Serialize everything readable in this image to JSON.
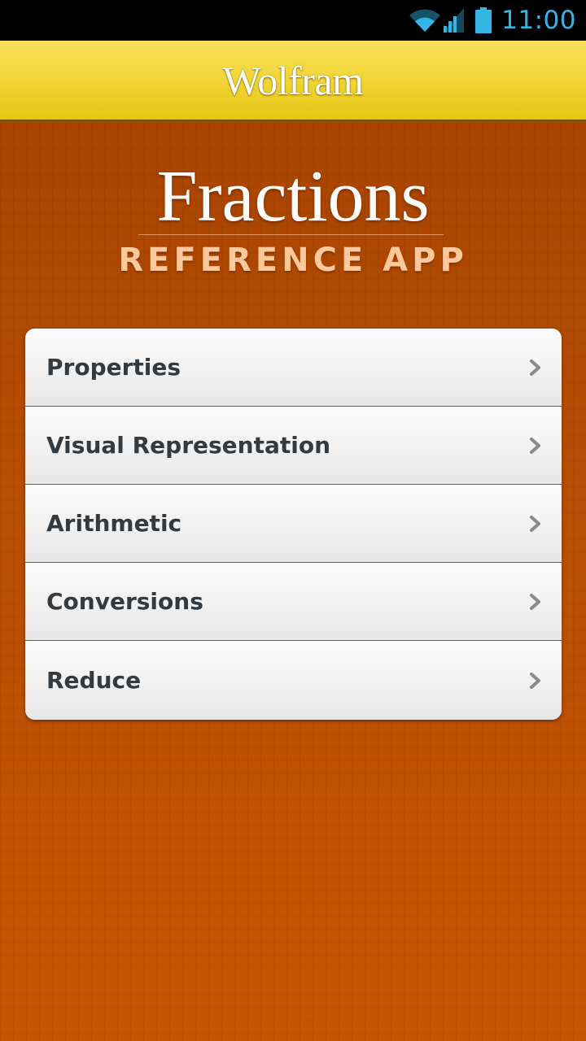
{
  "status_bar": {
    "time": "11:00",
    "icons": [
      "wifi-icon",
      "cell-signal-icon",
      "battery-icon"
    ],
    "color": "#33b5e5"
  },
  "header": {
    "brand": "Wolfram",
    "background": "#f2d63a"
  },
  "app": {
    "title": "Fractions",
    "subtitle": "REFERENCE APP",
    "background": "#b74e02"
  },
  "menu": {
    "items": [
      {
        "label": "Properties",
        "icon": "chevron-right-icon"
      },
      {
        "label": "Visual Representation",
        "icon": "chevron-right-icon"
      },
      {
        "label": "Arithmetic",
        "icon": "chevron-right-icon"
      },
      {
        "label": "Conversions",
        "icon": "chevron-right-icon"
      },
      {
        "label": "Reduce",
        "icon": "chevron-right-icon"
      }
    ]
  }
}
